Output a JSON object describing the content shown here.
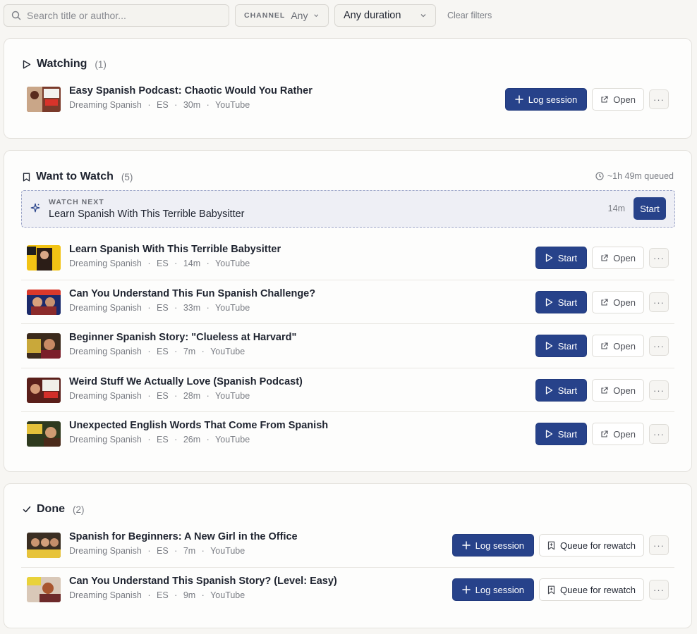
{
  "filters": {
    "search_placeholder": "Search title or author...",
    "channel_label": "CHANNEL",
    "channel_value": "Any",
    "duration_value": "Any duration",
    "clear_label": "Clear filters"
  },
  "watching": {
    "title": "Watching",
    "count": "(1)",
    "items": [
      {
        "title": "Easy Spanish Podcast: Chaotic Would You Rather",
        "channel": "Dreaming Spanish",
        "lang": "ES",
        "duration": "30m",
        "source": "YouTube"
      }
    ],
    "primary_label": "Log session",
    "open_label": "Open"
  },
  "want": {
    "title": "Want to Watch",
    "count": "(5)",
    "queued": "~1h 49m queued",
    "next": {
      "label": "WATCH NEXT",
      "title": "Learn Spanish With This Terrible Babysitter",
      "duration": "14m",
      "button": "Start"
    },
    "items": [
      {
        "title": "Learn Spanish With This Terrible Babysitter",
        "channel": "Dreaming Spanish",
        "lang": "ES",
        "duration": "14m",
        "source": "YouTube"
      },
      {
        "title": "Can You Understand This Fun Spanish Challenge?",
        "channel": "Dreaming Spanish",
        "lang": "ES",
        "duration": "33m",
        "source": "YouTube"
      },
      {
        "title": "Beginner Spanish Story: \"Clueless at Harvard\"",
        "channel": "Dreaming Spanish",
        "lang": "ES",
        "duration": "7m",
        "source": "YouTube"
      },
      {
        "title": "Weird Stuff We Actually Love (Spanish Podcast)",
        "channel": "Dreaming Spanish",
        "lang": "ES",
        "duration": "28m",
        "source": "YouTube"
      },
      {
        "title": "Unexpected English Words That Come From Spanish",
        "channel": "Dreaming Spanish",
        "lang": "ES",
        "duration": "26m",
        "source": "YouTube"
      }
    ],
    "primary_label": "Start",
    "open_label": "Open"
  },
  "done": {
    "title": "Done",
    "count": "(2)",
    "items": [
      {
        "title": "Spanish for Beginners: A New Girl in the Office",
        "channel": "Dreaming Spanish",
        "lang": "ES",
        "duration": "7m",
        "source": "YouTube"
      },
      {
        "title": "Can You Understand This Spanish Story? (Level: Easy)",
        "channel": "Dreaming Spanish",
        "lang": "ES",
        "duration": "9m",
        "source": "YouTube"
      }
    ],
    "primary_label": "Log session",
    "secondary_label": "Queue for rewatch"
  },
  "meta_sep": "·",
  "more_glyph": "···",
  "colors": {
    "accent": "#27428a",
    "background": "#f7f6f3"
  },
  "icons": [
    "search-icon",
    "chevron-down-icon",
    "play-outline-icon",
    "bookmark-icon",
    "clock-icon",
    "sparkle-icon",
    "plus-icon",
    "external-link-icon",
    "more-icon",
    "checkmark-icon",
    "play-icon"
  ]
}
